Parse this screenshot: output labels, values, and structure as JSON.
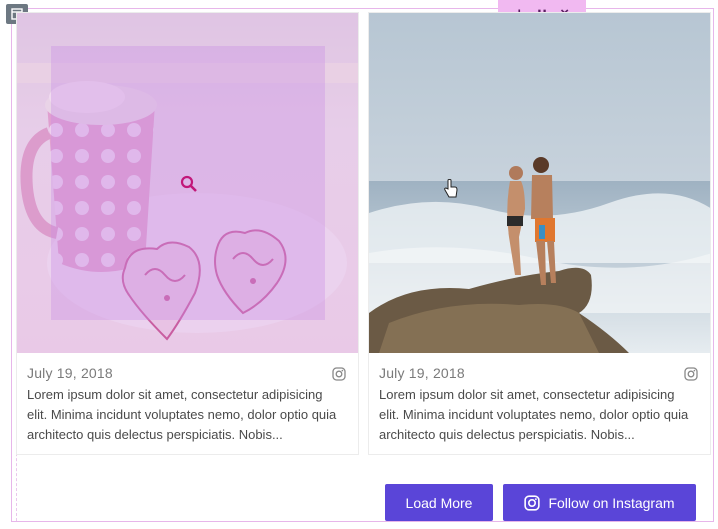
{
  "toolbar": {
    "add": "+",
    "move": "∷",
    "close": "×"
  },
  "posts": [
    {
      "date": "July 19, 2018",
      "caption": "Lorem ipsum dolor sit amet, consectetur adipisicing elit. Minima incidunt voluptates nemo, dolor optio quia architecto quis delectus perspiciatis. Nobis..."
    },
    {
      "date": "July 19, 2018",
      "caption": "Lorem ipsum dolor sit amet, consectetur adipisicing elit. Minima incidunt voluptates nemo, dolor optio quia architecto quis delectus perspiciatis. Nobis..."
    }
  ],
  "buttons": {
    "load_more": "Load More",
    "follow": "Follow on Instagram"
  },
  "colors": {
    "button": "#5a45d8",
    "hover_overlay": "#c98ce6",
    "toolbar": "#f1b9f1"
  }
}
